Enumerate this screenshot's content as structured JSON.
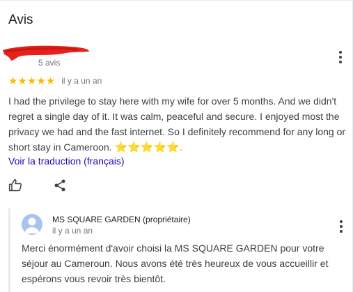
{
  "section": {
    "title": "Avis"
  },
  "review": {
    "count_label": "5 avis",
    "rating": 5,
    "stars_text": "★★★★★",
    "time": "il y a un an",
    "text": "I had the privilege to stay here with my wife for over 5 months. And we didn't regret a single day of it. It was calm, peaceful and secure. I enjoyed most the privacy we had and the fast internet. So I definitely recommend for any long or short stay in Cameroon.",
    "emoji_stars": "⭐⭐⭐⭐⭐.",
    "translate_label": "Voir la traduction (français)"
  },
  "actions": {
    "like_icon": "thumb-up-icon",
    "share_icon": "share-icon",
    "menu_icon": "more-vert-icon"
  },
  "owner_reply": {
    "name": "MS SQUARE GARDEN",
    "role": "(propriétaire)",
    "time": "il y a un an",
    "text": "Merci énormément d'avoir choisi la MS SQUARE GARDEN pour votre séjour au Cameroun. Nous avons été très heureux de vous accueillir et espérons vous revoir très bientôt."
  },
  "colors": {
    "star": "#fbbc04",
    "link": "#1a0dab",
    "redaction": "#e8201a",
    "avatar_bg": "#a9c3ee",
    "avatar_fg": "#ffffff"
  }
}
